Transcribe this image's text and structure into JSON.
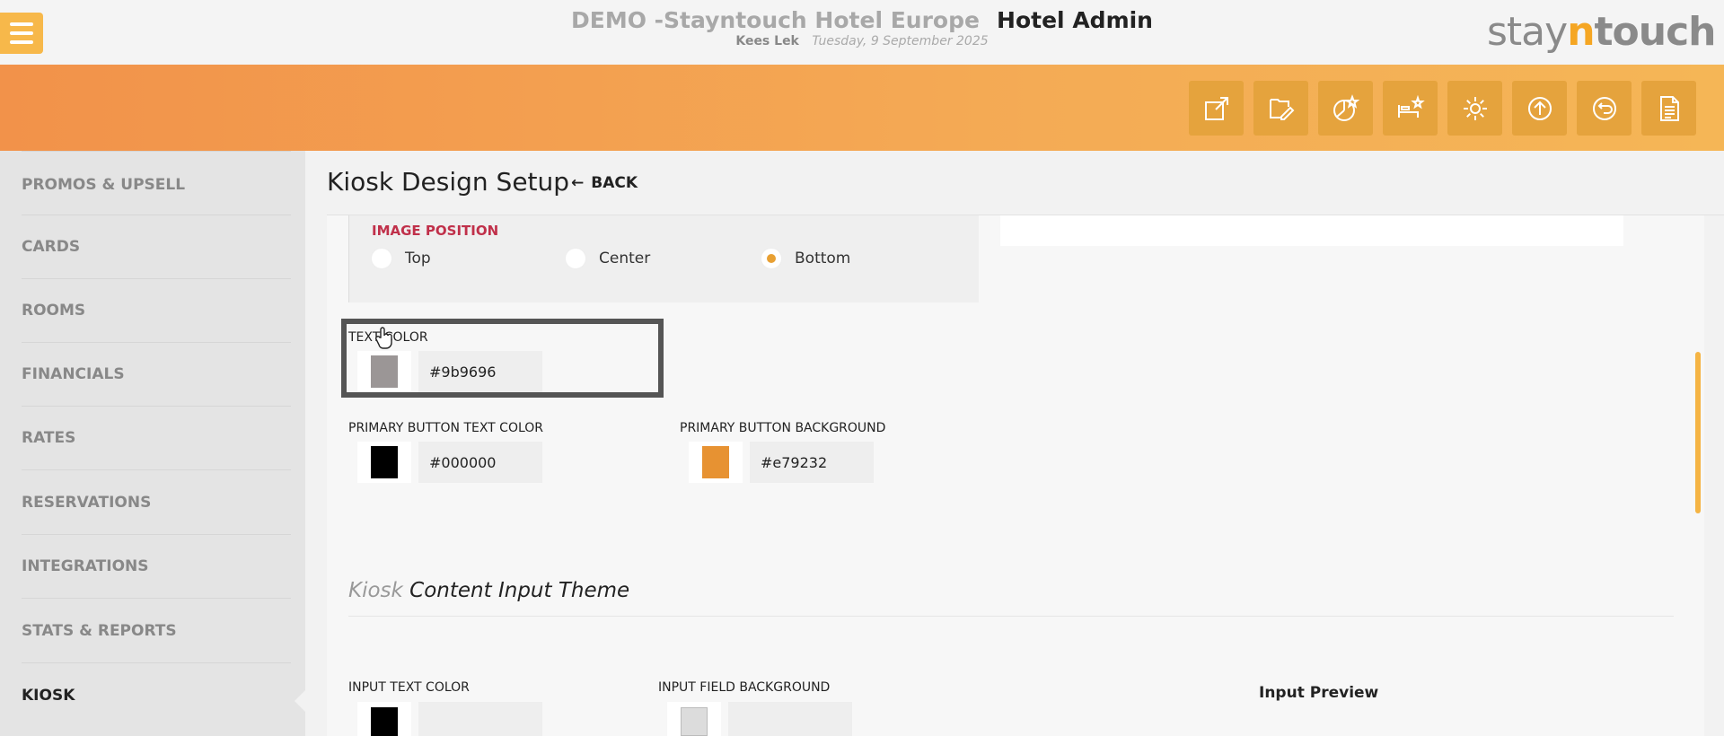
{
  "header": {
    "hotel_name": "DEMO -Stayntouch Hotel Europe",
    "admin_label": "Hotel Admin",
    "user_name": "Kees Lek",
    "date": "Tuesday, 9 September 2025",
    "logo": {
      "part1": "stay",
      "part2": "n",
      "part3": "touch"
    }
  },
  "toolbar": {
    "icons": [
      "external-link-icon",
      "edit-document-icon",
      "chart-star-icon",
      "bed-star-icon",
      "gear-icon",
      "upload-icon",
      "return-icon",
      "document-icon"
    ]
  },
  "sidebar": {
    "items": [
      {
        "label": "PROMOS & UPSELL"
      },
      {
        "label": "CARDS"
      },
      {
        "label": "ROOMS"
      },
      {
        "label": "FINANCIALS"
      },
      {
        "label": "RATES"
      },
      {
        "label": "RESERVATIONS"
      },
      {
        "label": "INTEGRATIONS"
      },
      {
        "label": "STATS & REPORTS"
      },
      {
        "label": "KIOSK"
      }
    ],
    "active": "KIOSK"
  },
  "page": {
    "title": "Kiosk Design Setup",
    "back_label": "BACK"
  },
  "image_position": {
    "label": "IMAGE POSITION",
    "options": [
      "Top",
      "Center",
      "Bottom"
    ],
    "selected": "Bottom"
  },
  "colors": {
    "text_color": {
      "label": "TEXT COLOR",
      "value": "#9b9696",
      "swatch": "#9b9696"
    },
    "primary_button_text": {
      "label": "PRIMARY BUTTON TEXT COLOR",
      "value": "#000000",
      "swatch": "#000000"
    },
    "primary_button_bg": {
      "label": "PRIMARY BUTTON BACKGROUND",
      "value": "#e79232",
      "swatch": "#e79232"
    }
  },
  "content_input_theme": {
    "title_muted": "Kiosk",
    "title_main": "Content Input Theme",
    "input_text_color_label": "INPUT TEXT COLOR",
    "input_field_bg_label": "INPUT FIELD BACKGROUND",
    "preview_label": "Input Preview"
  },
  "theme": {
    "accent": "#f5a623",
    "error_label": "#c0304a"
  }
}
